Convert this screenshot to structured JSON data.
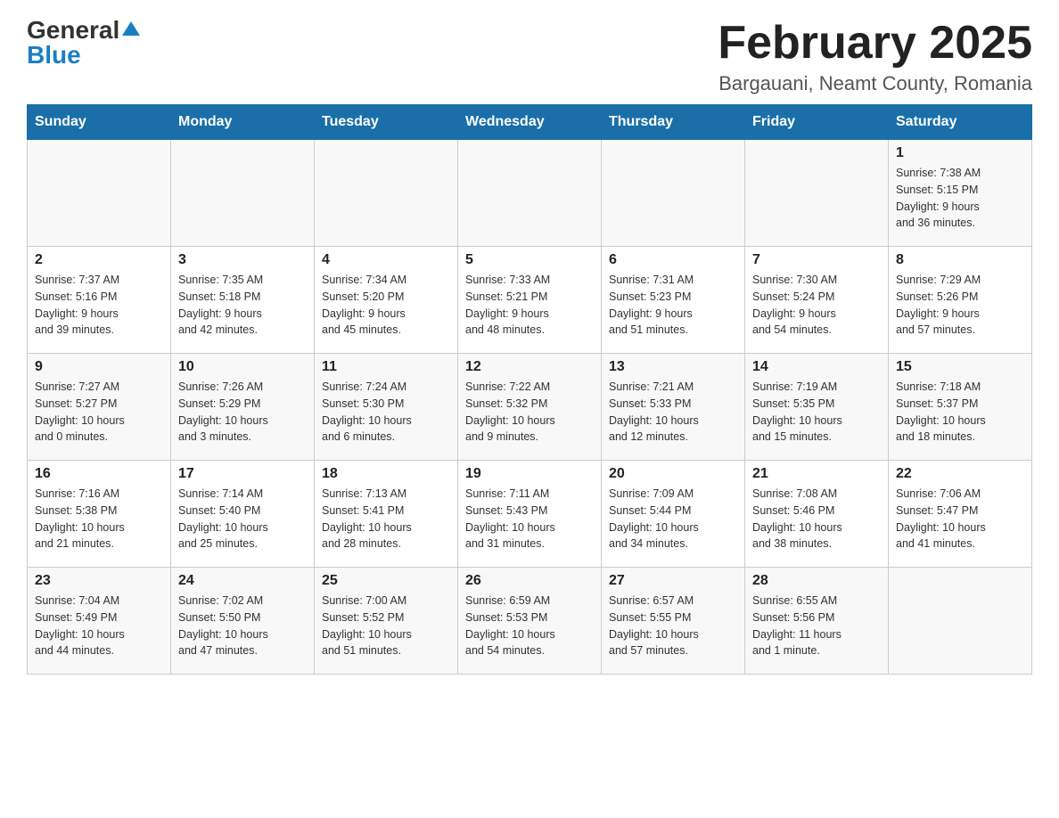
{
  "logo": {
    "general": "General",
    "blue": "Blue",
    "triangle": "▶"
  },
  "title": "February 2025",
  "subtitle": "Bargauani, Neamt County, Romania",
  "weekdays": [
    "Sunday",
    "Monday",
    "Tuesday",
    "Wednesday",
    "Thursday",
    "Friday",
    "Saturday"
  ],
  "rows": [
    [
      {
        "day": "",
        "info": ""
      },
      {
        "day": "",
        "info": ""
      },
      {
        "day": "",
        "info": ""
      },
      {
        "day": "",
        "info": ""
      },
      {
        "day": "",
        "info": ""
      },
      {
        "day": "",
        "info": ""
      },
      {
        "day": "1",
        "info": "Sunrise: 7:38 AM\nSunset: 5:15 PM\nDaylight: 9 hours\nand 36 minutes."
      }
    ],
    [
      {
        "day": "2",
        "info": "Sunrise: 7:37 AM\nSunset: 5:16 PM\nDaylight: 9 hours\nand 39 minutes."
      },
      {
        "day": "3",
        "info": "Sunrise: 7:35 AM\nSunset: 5:18 PM\nDaylight: 9 hours\nand 42 minutes."
      },
      {
        "day": "4",
        "info": "Sunrise: 7:34 AM\nSunset: 5:20 PM\nDaylight: 9 hours\nand 45 minutes."
      },
      {
        "day": "5",
        "info": "Sunrise: 7:33 AM\nSunset: 5:21 PM\nDaylight: 9 hours\nand 48 minutes."
      },
      {
        "day": "6",
        "info": "Sunrise: 7:31 AM\nSunset: 5:23 PM\nDaylight: 9 hours\nand 51 minutes."
      },
      {
        "day": "7",
        "info": "Sunrise: 7:30 AM\nSunset: 5:24 PM\nDaylight: 9 hours\nand 54 minutes."
      },
      {
        "day": "8",
        "info": "Sunrise: 7:29 AM\nSunset: 5:26 PM\nDaylight: 9 hours\nand 57 minutes."
      }
    ],
    [
      {
        "day": "9",
        "info": "Sunrise: 7:27 AM\nSunset: 5:27 PM\nDaylight: 10 hours\nand 0 minutes."
      },
      {
        "day": "10",
        "info": "Sunrise: 7:26 AM\nSunset: 5:29 PM\nDaylight: 10 hours\nand 3 minutes."
      },
      {
        "day": "11",
        "info": "Sunrise: 7:24 AM\nSunset: 5:30 PM\nDaylight: 10 hours\nand 6 minutes."
      },
      {
        "day": "12",
        "info": "Sunrise: 7:22 AM\nSunset: 5:32 PM\nDaylight: 10 hours\nand 9 minutes."
      },
      {
        "day": "13",
        "info": "Sunrise: 7:21 AM\nSunset: 5:33 PM\nDaylight: 10 hours\nand 12 minutes."
      },
      {
        "day": "14",
        "info": "Sunrise: 7:19 AM\nSunset: 5:35 PM\nDaylight: 10 hours\nand 15 minutes."
      },
      {
        "day": "15",
        "info": "Sunrise: 7:18 AM\nSunset: 5:37 PM\nDaylight: 10 hours\nand 18 minutes."
      }
    ],
    [
      {
        "day": "16",
        "info": "Sunrise: 7:16 AM\nSunset: 5:38 PM\nDaylight: 10 hours\nand 21 minutes."
      },
      {
        "day": "17",
        "info": "Sunrise: 7:14 AM\nSunset: 5:40 PM\nDaylight: 10 hours\nand 25 minutes."
      },
      {
        "day": "18",
        "info": "Sunrise: 7:13 AM\nSunset: 5:41 PM\nDaylight: 10 hours\nand 28 minutes."
      },
      {
        "day": "19",
        "info": "Sunrise: 7:11 AM\nSunset: 5:43 PM\nDaylight: 10 hours\nand 31 minutes."
      },
      {
        "day": "20",
        "info": "Sunrise: 7:09 AM\nSunset: 5:44 PM\nDaylight: 10 hours\nand 34 minutes."
      },
      {
        "day": "21",
        "info": "Sunrise: 7:08 AM\nSunset: 5:46 PM\nDaylight: 10 hours\nand 38 minutes."
      },
      {
        "day": "22",
        "info": "Sunrise: 7:06 AM\nSunset: 5:47 PM\nDaylight: 10 hours\nand 41 minutes."
      }
    ],
    [
      {
        "day": "23",
        "info": "Sunrise: 7:04 AM\nSunset: 5:49 PM\nDaylight: 10 hours\nand 44 minutes."
      },
      {
        "day": "24",
        "info": "Sunrise: 7:02 AM\nSunset: 5:50 PM\nDaylight: 10 hours\nand 47 minutes."
      },
      {
        "day": "25",
        "info": "Sunrise: 7:00 AM\nSunset: 5:52 PM\nDaylight: 10 hours\nand 51 minutes."
      },
      {
        "day": "26",
        "info": "Sunrise: 6:59 AM\nSunset: 5:53 PM\nDaylight: 10 hours\nand 54 minutes."
      },
      {
        "day": "27",
        "info": "Sunrise: 6:57 AM\nSunset: 5:55 PM\nDaylight: 10 hours\nand 57 minutes."
      },
      {
        "day": "28",
        "info": "Sunrise: 6:55 AM\nSunset: 5:56 PM\nDaylight: 11 hours\nand 1 minute."
      },
      {
        "day": "",
        "info": ""
      }
    ]
  ]
}
